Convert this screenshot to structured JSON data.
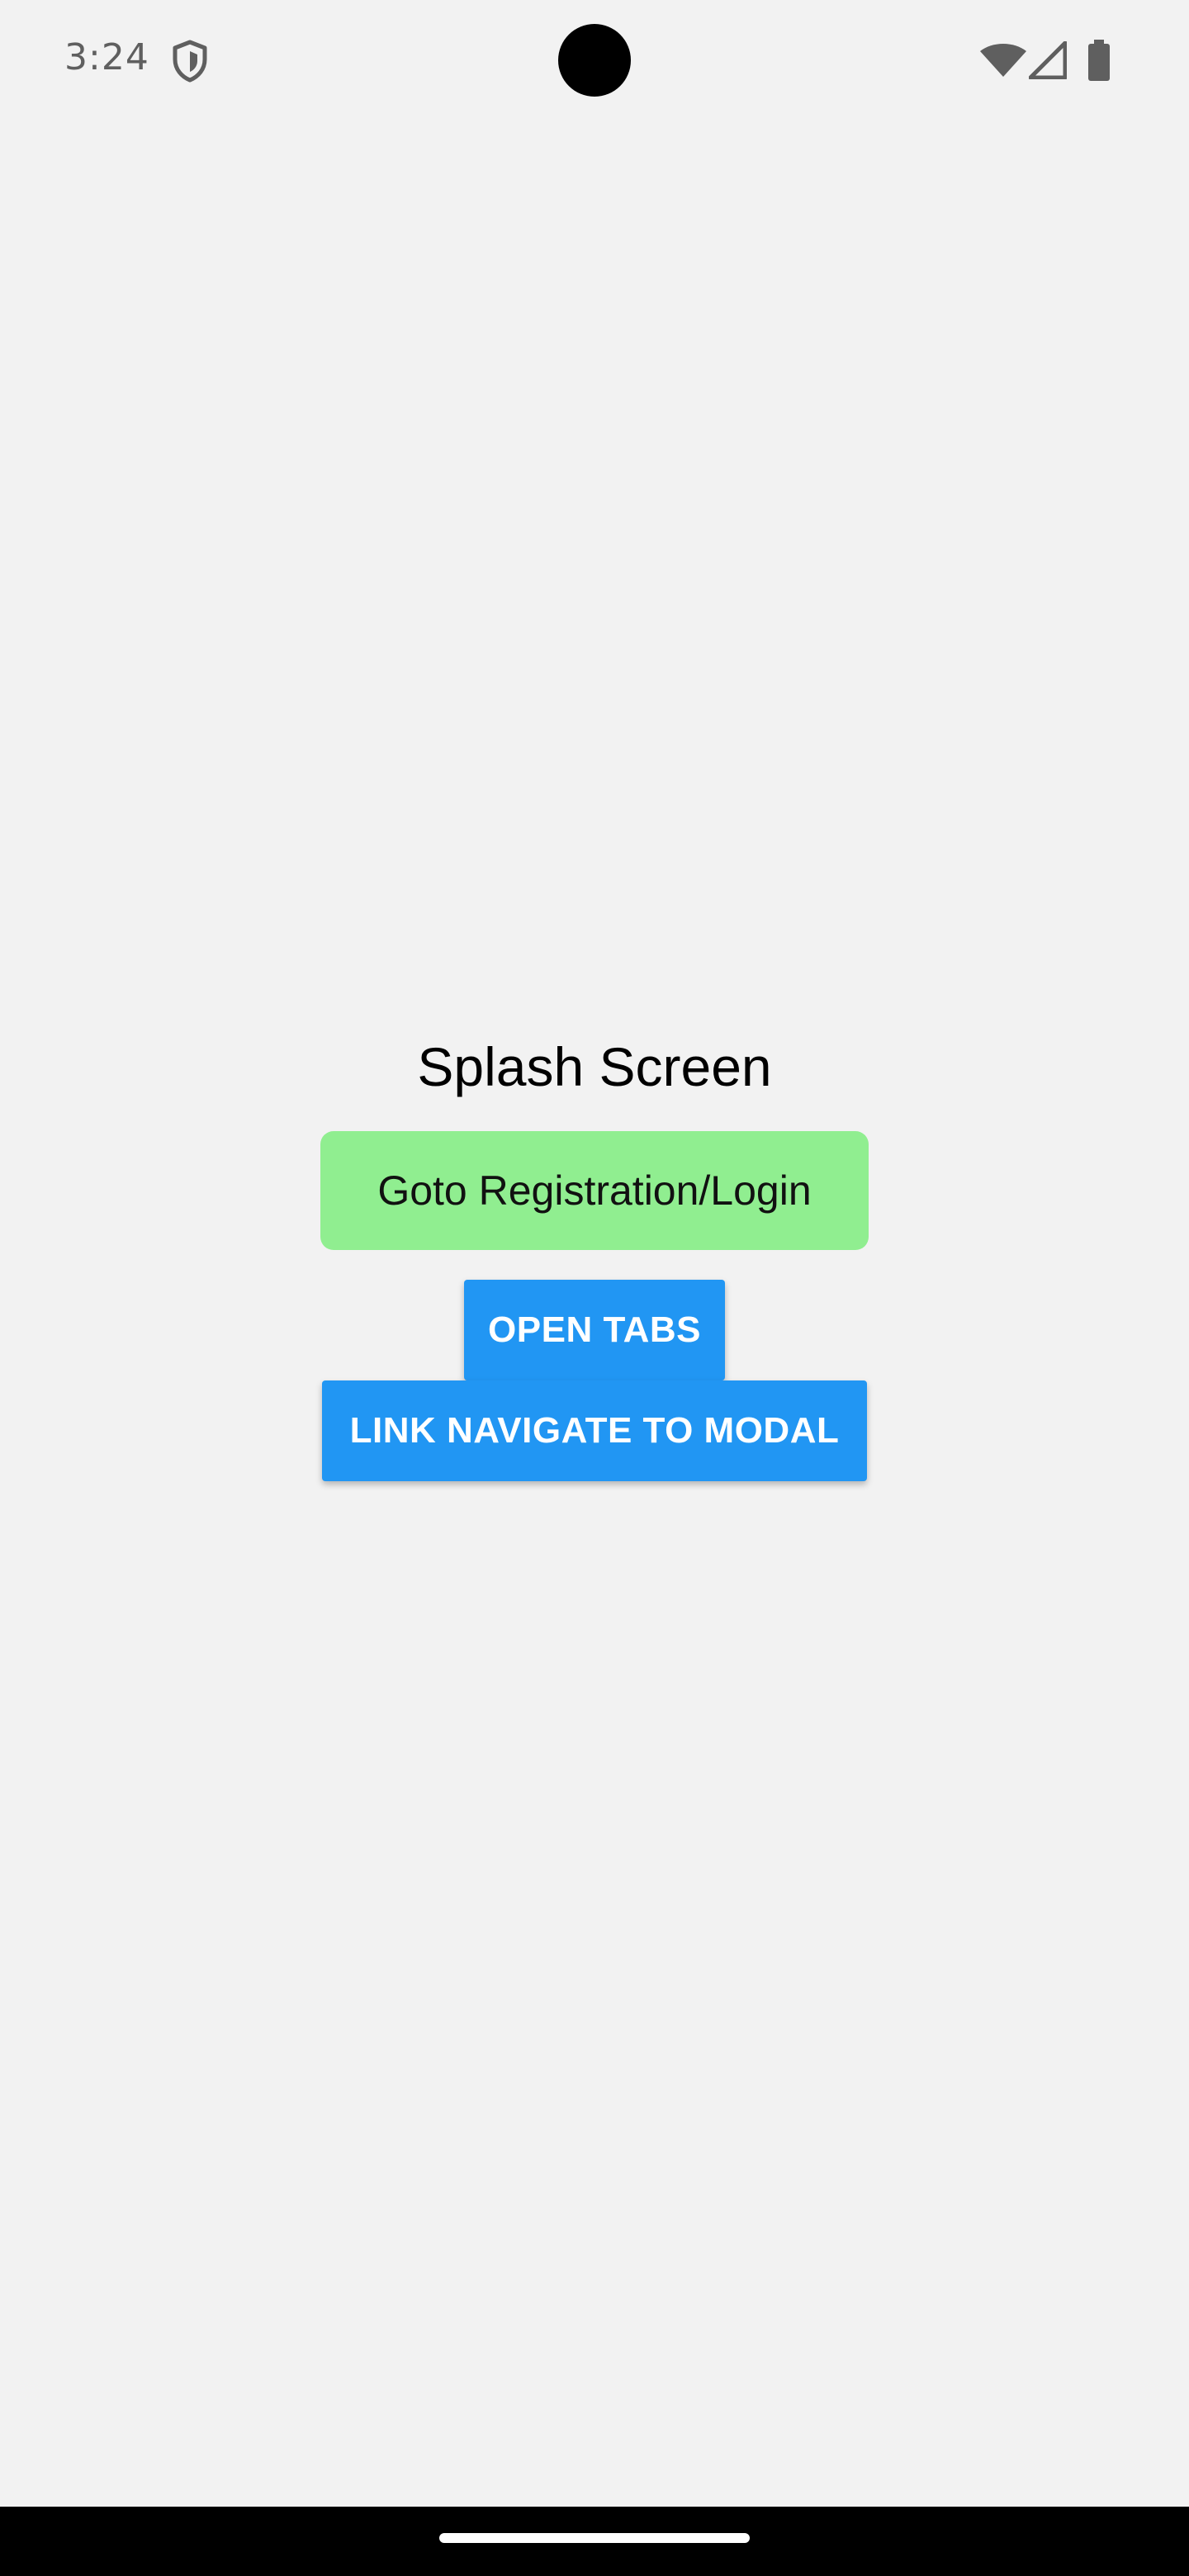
{
  "status_bar": {
    "time": "3:24",
    "icons": [
      "shield-icon",
      "wifi-icon",
      "signal-icon",
      "battery-icon"
    ]
  },
  "main": {
    "title": "Splash Screen",
    "goto_button_label": "Goto Registration/Login",
    "open_tabs_label": "OPEN TABS",
    "modal_link_label": "LINK NAVIGATE TO MODAL"
  },
  "colors": {
    "background": "#f2f2f2",
    "goto_button": "#90ee90",
    "primary_button": "#2196f3",
    "nav_bar": "#000000"
  }
}
